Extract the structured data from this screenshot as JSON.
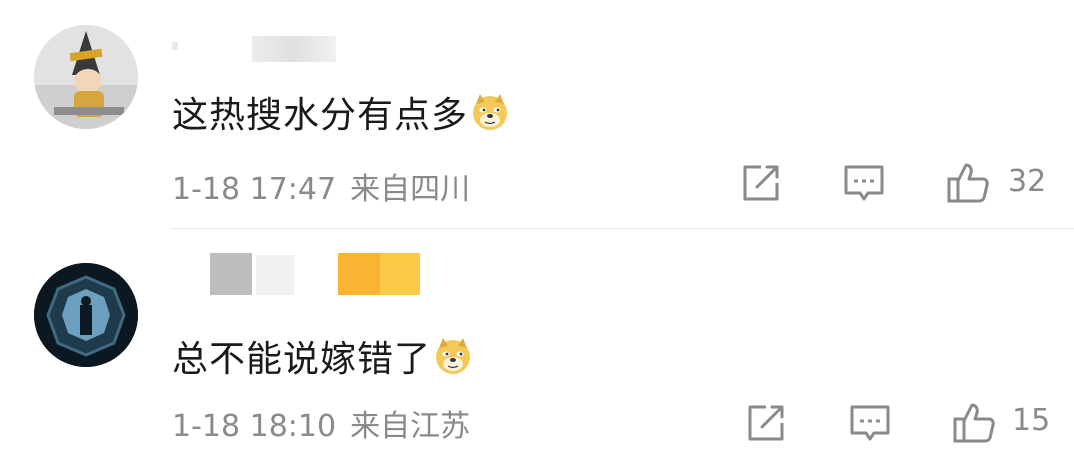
{
  "comments": [
    {
      "text": "这热搜水分有点多",
      "emoji": "doge-emoji",
      "time": "1-18 17:47",
      "location": "来自四川",
      "likes": "32",
      "avatar": "hat-figure-avatar"
    },
    {
      "text": "总不能说嫁错了",
      "emoji": "doge-emoji",
      "time": "1-18 18:10",
      "location": "来自江苏",
      "likes": "15",
      "avatar": "tunnel-figure-avatar"
    }
  ],
  "icons": {
    "share": "share-icon",
    "comment": "comment-icon",
    "like": "thumbs-up-icon"
  },
  "colors": {
    "text": "#1a1a1a",
    "meta": "#8a8a8a",
    "icon": "#8a8a8a",
    "name_blur_yellow": "#f9b531"
  }
}
